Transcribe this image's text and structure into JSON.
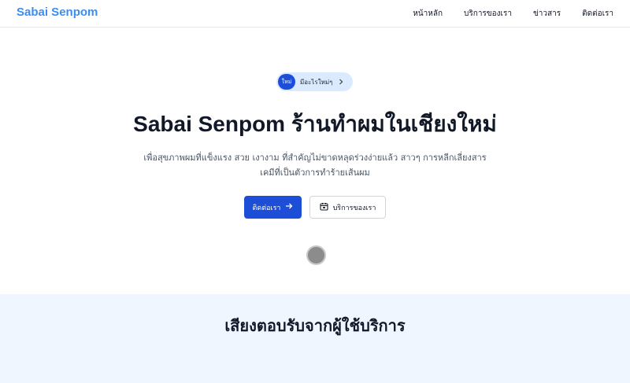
{
  "nav": {
    "brand": "Sabai Senpom",
    "links": [
      "หน้าหลัก",
      "บริการของเรา",
      "ข่าวสาร",
      "ติดต่อเรา"
    ]
  },
  "hero": {
    "badge": "ใหม่",
    "announcement": "มีอะไรใหม่ๆ",
    "title": "Sabai Senpom ร้านทำผมในเชียงใหม่",
    "subtitle": "เพื่อสุขภาพผมที่แข็งแรง สวย เงางาม ที่สำคัญไม่ขาดหลุดร่วงง่ายแล้ว สาวๆ การหลีกเลี่ยงสารเคมีที่เป็นตัวการทำร้ายเส้นผม",
    "primary_button": "ติดต่อเรา",
    "secondary_button": "บริการของเรา"
  },
  "testimonials": {
    "title": "เสียงตอบรับจากผู้ใช้บริการ"
  },
  "colors": {
    "brand": "#3b8ef0",
    "primary": "#1d4ed8",
    "section_bg": "#eff6ff"
  },
  "icons": {
    "announce_chevron": "chevron-right-icon",
    "primary_button": "arrow-right-icon",
    "secondary_button": "calendar-icon"
  }
}
